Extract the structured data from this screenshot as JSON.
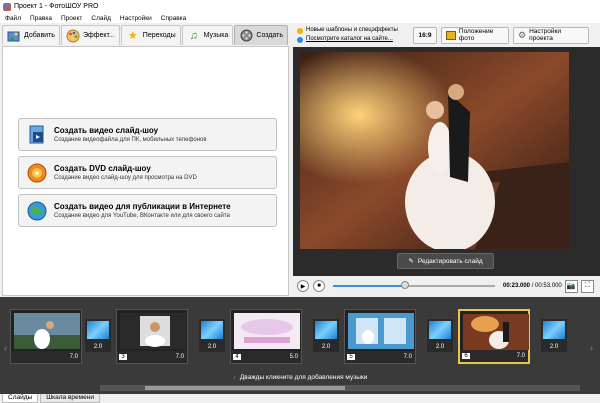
{
  "window": {
    "title": "Проект 1 - ФотоШОУ PRO"
  },
  "menu": [
    "Файл",
    "Правка",
    "Проект",
    "Слайд",
    "Настройки",
    "Справка"
  ],
  "tabs": [
    {
      "label": "Добавить",
      "icon": "add-photo-icon"
    },
    {
      "label": "Эффект...",
      "icon": "palette-icon"
    },
    {
      "label": "Переходы",
      "icon": "star-icon"
    },
    {
      "label": "Музыка",
      "icon": "music-note-icon"
    },
    {
      "label": "Создать",
      "icon": "film-reel-icon",
      "active": true
    }
  ],
  "create_options": [
    {
      "title": "Создать видео слайд-шоу",
      "subtitle": "Создание видеофайла для ПК, мобильных телефонов",
      "icon": "video-file-icon"
    },
    {
      "title": "Создать DVD слайд-шоу",
      "subtitle": "Создание видео слайд-шоу для просмотра на DVD",
      "icon": "dvd-disc-icon"
    },
    {
      "title": "Создать видео для публикации в Интернете",
      "subtitle": "Создание видео для YouTube, ВКонтакте или для своего сайта",
      "icon": "globe-icon"
    }
  ],
  "top_links": {
    "line1": "Новые шаблоны и спецэффекты",
    "line2": "Посмотрите каталог на сайте..."
  },
  "toolbar": {
    "aspect": "16:9",
    "photo_position": "Положение фото",
    "project_settings": "Настройки проекта"
  },
  "preview": {
    "edit_button": "Редактировать слайд"
  },
  "player": {
    "current": "00:23.000",
    "total": "00:53.000",
    "separator": "/",
    "progress": 0.43
  },
  "slides": [
    {
      "number": "",
      "duration": "7.0"
    },
    {
      "number": "3",
      "duration": "7.0"
    },
    {
      "number": "4",
      "duration": "5.0"
    },
    {
      "number": "5",
      "duration": "7.0"
    },
    {
      "number": "6",
      "duration": "7.0",
      "selected": true
    }
  ],
  "transitions": [
    "2.0",
    "2.0",
    "2.0",
    "2.0",
    "2.0"
  ],
  "timeline": {
    "music_hint": "Дважды кликните для добавления музыки"
  },
  "bottom_tabs": [
    "Слайды",
    "Шкала времени"
  ]
}
